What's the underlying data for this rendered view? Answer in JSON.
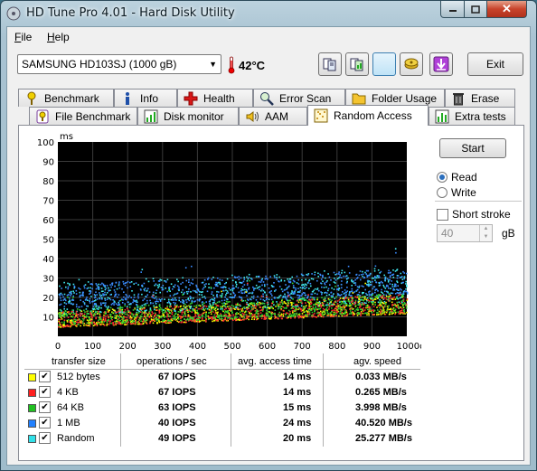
{
  "window": {
    "title": "HD Tune Pro 4.01 - Hard Disk Utility",
    "close_label": "✕"
  },
  "menu": {
    "items": [
      {
        "key": "F",
        "rest": "ile"
      },
      {
        "key": "H",
        "rest": "elp"
      }
    ]
  },
  "toolbar": {
    "drive": "SAMSUNG HD103SJ (1000 gB)",
    "temperature": "42°C",
    "exit_label": "Exit"
  },
  "tabs": {
    "row1": [
      "Benchmark",
      "Info",
      "Health",
      "Error Scan",
      "Folder Usage",
      "Erase"
    ],
    "row2": [
      "File Benchmark",
      "Disk monitor",
      "AAM",
      "Random Access",
      "Extra tests"
    ],
    "selected": "Random Access"
  },
  "controls": {
    "start_label": "Start",
    "read_label": "Read",
    "write_label": "Write",
    "mode": "read",
    "short_stroke_label": "Short stroke",
    "short_stroke_checked": false,
    "stroke_value": "40",
    "stroke_unit": "gB"
  },
  "results": {
    "headers": [
      "transfer size",
      "operations / sec",
      "avg. access time",
      "agv. speed"
    ],
    "rows": [
      {
        "color": "#ffff00",
        "size": "512 bytes",
        "iops": "67 IOPS",
        "access": "14 ms",
        "speed": "0.033 MB/s",
        "checked": true
      },
      {
        "color": "#ff2020",
        "size": "4 KB",
        "iops": "67 IOPS",
        "access": "14 ms",
        "speed": "0.265 MB/s",
        "checked": true
      },
      {
        "color": "#20c020",
        "size": "64 KB",
        "iops": "63 IOPS",
        "access": "15 ms",
        "speed": "3.998 MB/s",
        "checked": true
      },
      {
        "color": "#2080ff",
        "size": "1 MB",
        "iops": "40 IOPS",
        "access": "24 ms",
        "speed": "40.520 MB/s",
        "checked": true
      },
      {
        "color": "#30e0e8",
        "size": "Random",
        "iops": "49 IOPS",
        "access": "20 ms",
        "speed": "25.277 MB/s",
        "checked": true
      }
    ]
  },
  "chart_data": {
    "type": "scatter",
    "y_unit": "ms",
    "x_unit": "gB",
    "ylim": [
      0,
      100
    ],
    "xlim": [
      0,
      1000
    ],
    "y_ticks": [
      "100",
      "90",
      "80",
      "70",
      "60",
      "50",
      "40",
      "30",
      "20",
      "10"
    ],
    "x_ticks": [
      "0",
      "100",
      "200",
      "300",
      "400",
      "500",
      "600",
      "700",
      "800",
      "900",
      "1000gB"
    ],
    "grid": true,
    "series": [
      {
        "color": "#ffff00",
        "band_start": [
          5,
          13
        ],
        "band_end": [
          12,
          22
        ]
      },
      {
        "color": "#ff3030",
        "band_start": [
          5,
          13
        ],
        "band_end": [
          12,
          22
        ]
      },
      {
        "color": "#30d030",
        "band_start": [
          6,
          14
        ],
        "band_end": [
          13,
          23
        ]
      },
      {
        "color": "#3a8cff",
        "band_start": [
          15,
          27
        ],
        "band_end": [
          22,
          35
        ]
      },
      {
        "color": "#40e8f0",
        "band_start": [
          11,
          28
        ],
        "band_end": [
          18,
          36
        ]
      }
    ]
  }
}
